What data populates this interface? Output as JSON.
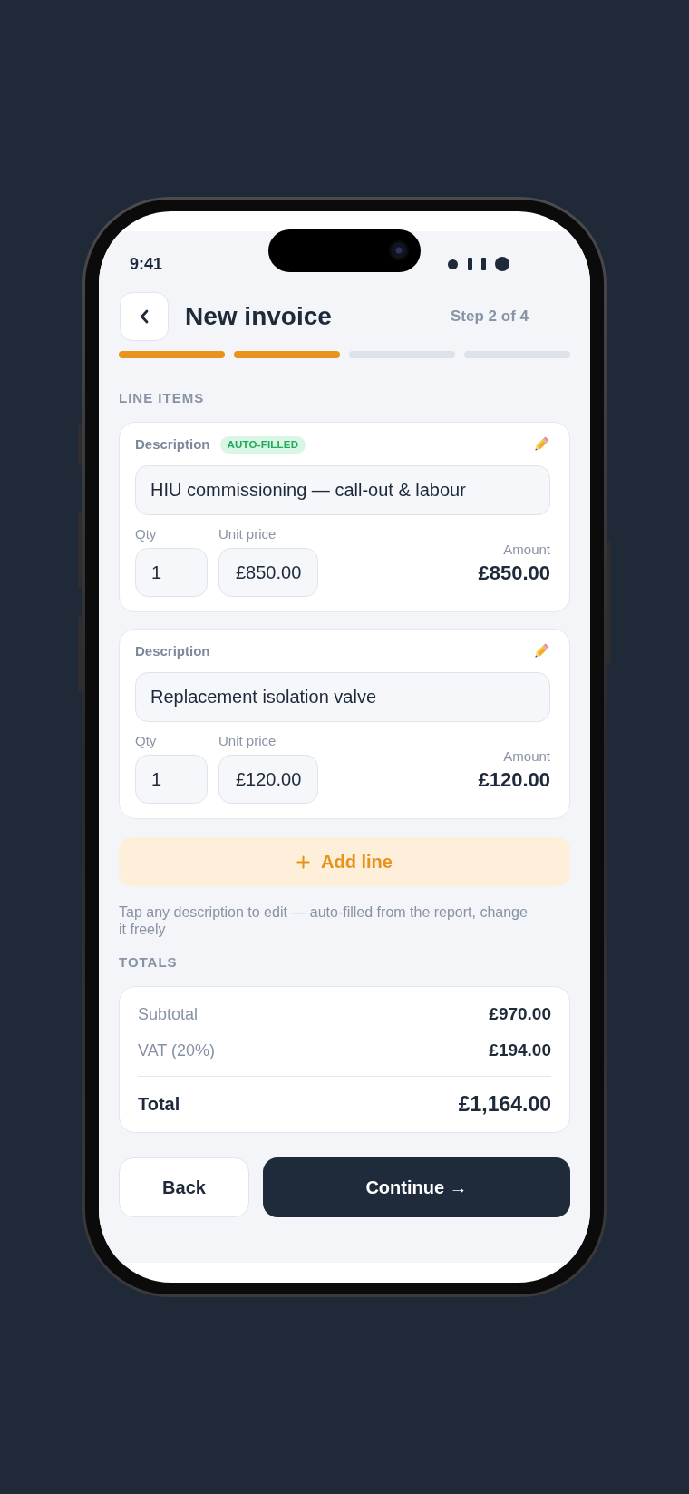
{
  "status_bar": {
    "time": "9:41"
  },
  "header": {
    "title": "New invoice",
    "step": "Step 2 of 4"
  },
  "progress": [
    {
      "done": true
    },
    {
      "done": true
    },
    {
      "done": false
    },
    {
      "done": false
    }
  ],
  "line_items": {
    "heading": "LINE ITEMS",
    "items": [
      {
        "description_label": "Description",
        "badge": "AUTO-FILLED",
        "description": "HIU commissioning — call-out & labour",
        "qty_label": "Qty",
        "qty": "1",
        "unit_price_label": "Unit price",
        "unit_price": "£850.00",
        "amount_label": "Amount",
        "amount": "£850.00"
      },
      {
        "description_label": "Description",
        "description": "Replacement isolation valve",
        "qty_label": "Qty",
        "qty": "1",
        "unit_price_label": "Unit price",
        "unit_price": "£120.00",
        "amount_label": "Amount",
        "amount": "£120.00"
      }
    ]
  },
  "add_line": {
    "label": "Add line"
  },
  "note": "Tap any description to edit — auto-filled from the report, change it freely",
  "totals": {
    "heading": "TOTALS",
    "rows": [
      {
        "label": "Subtotal",
        "value": "£970.00"
      },
      {
        "label": "VAT (20%)",
        "value": "£194.00"
      }
    ],
    "total": {
      "label": "Total",
      "value": "£1,164.00"
    }
  },
  "actions": {
    "back": "Back",
    "continue": "Continue →"
  }
}
